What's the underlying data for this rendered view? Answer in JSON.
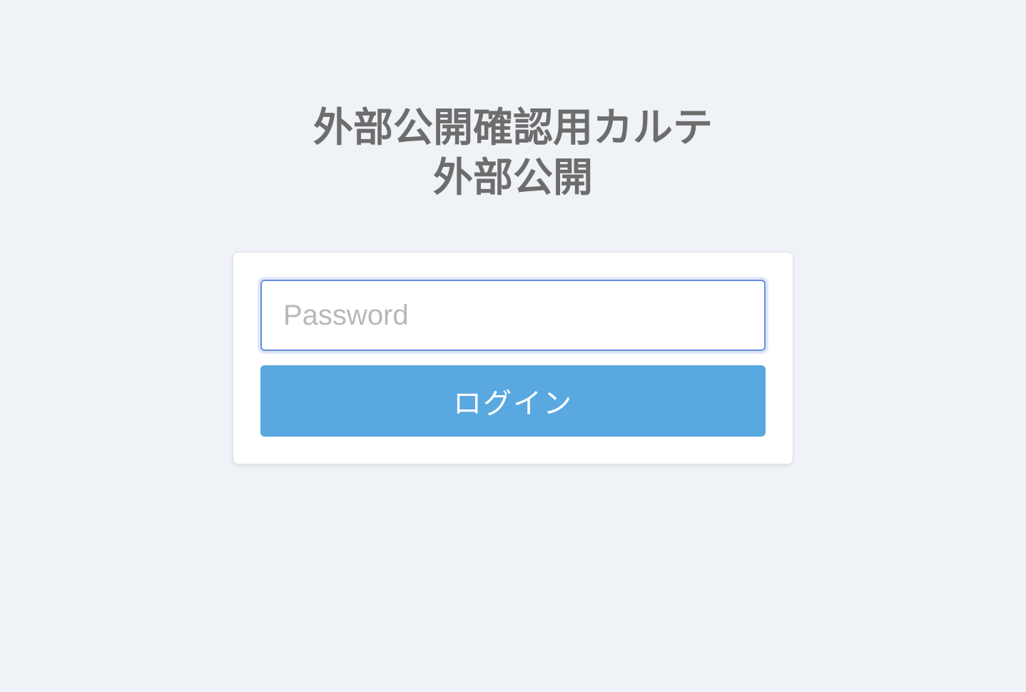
{
  "header": {
    "title_line1": "外部公開確認用カルテ",
    "title_line2": "外部公開"
  },
  "login": {
    "password_placeholder": "Password",
    "password_value": "",
    "button_label": "ログイン"
  }
}
